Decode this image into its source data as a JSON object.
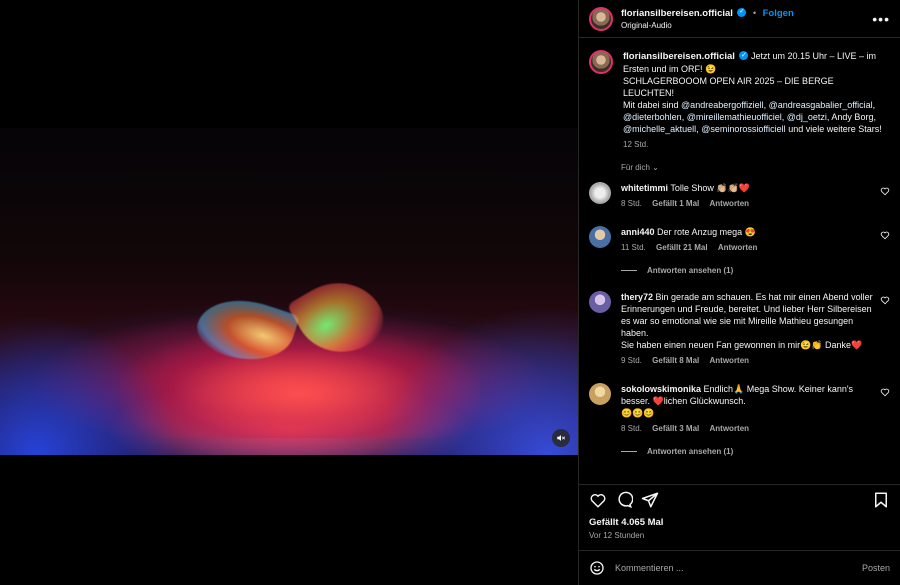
{
  "header": {
    "username": "floriansilbereisen.official",
    "separator": "•",
    "follow_label": "Folgen",
    "subline": "Original-Audio",
    "more_icon": "more-horizontal-icon"
  },
  "caption": {
    "username": "floriansilbereisen.official",
    "line1": "Jetzt um 20.15 Uhr – LIVE – im Ersten und im ORF! 😉",
    "line2": "SCHLAGERBOOOM OPEN AIR 2025 – DIE BERGE LEUCHTEN!",
    "line3_prefix": "Mit dabei sind",
    "mentions": [
      "@andreabergoffiziell",
      "@andreasgabalier_official",
      "@dieterbohlen",
      "@mireillemathieuofficiel",
      "@dj_oetzi",
      "@michelle_aktuell",
      "@seminorossiofficiell"
    ],
    "andy_borg": "Andy Borg,",
    "tail": "und viele weitere Stars!",
    "time": "12 Std."
  },
  "translate_label": "Für dich",
  "comments": [
    {
      "username": "whitetimmi",
      "text": "Tolle Show 👏🏼👏🏼❤️",
      "time": "8 Std.",
      "likes": "Gefällt 1 Mal",
      "reply": "Antworten"
    },
    {
      "username": "anni440",
      "text": "Der rote Anzug mega 😍",
      "time": "11 Std.",
      "likes": "Gefällt 21 Mal",
      "reply": "Antworten",
      "replies": "Antworten ansehen (1)"
    },
    {
      "username": "thery72",
      "text": "Bin gerade am schauen. Es hat mir einen Abend voller Erinnerungen und Freude, bereitet. Und lieber Herr Silbereisen es war so emotional wie sie mit Mireille Mathieu gesungen haben.",
      "text2": "Sie haben einen neuen Fan gewonnen in mir😉👏 Danke❤️",
      "time": "9 Std.",
      "likes": "Gefällt 8 Mal",
      "reply": "Antworten"
    },
    {
      "username": "sokolowskimonika",
      "text": "Endlich🙏 Mega Show. Keiner kann's besser. ❤️lichen Glückwunsch.",
      "text2": "😊😊😊",
      "time": "8 Std.",
      "likes": "Gefällt 3 Mal",
      "reply": "Antworten",
      "replies": "Antworten ansehen (1)"
    }
  ],
  "likes_total": "Gefällt 4.065 Mal",
  "post_age": "Vor 12 Stunden",
  "comment_placeholder": "Kommentieren ...",
  "post_label": "Posten",
  "colors": {
    "link": "#e0f1ff",
    "follow": "#0095f6",
    "heart_red": "#ed4956"
  }
}
